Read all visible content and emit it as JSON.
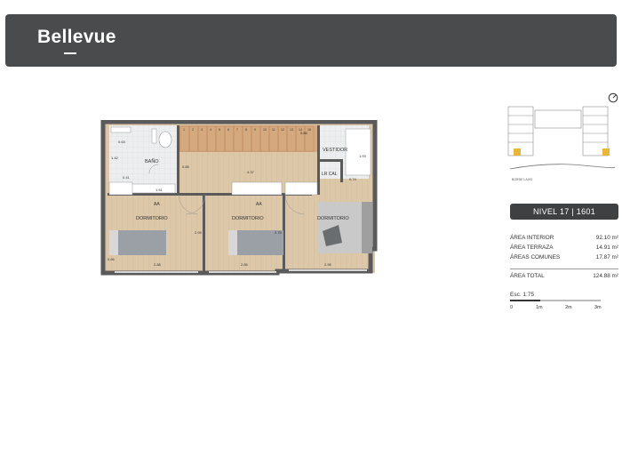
{
  "brand": {
    "name": "Bellevue"
  },
  "plan": {
    "stair_steps": [
      "1",
      "2",
      "3",
      "4",
      "5",
      "6",
      "7",
      "8",
      "9",
      "10",
      "11",
      "12",
      "13",
      "14",
      "15"
    ],
    "rooms": {
      "bath": "BAÑO",
      "vestibule": "VESTIDOR",
      "utility": "LR CAL",
      "bed1": "DORMITORIO",
      "bed2": "DORMITORIO",
      "bed3": "DORMITORIO",
      "ac1": "AA",
      "ac2": "AA"
    },
    "dims": {
      "d1": "0.63",
      "d2": "1.42",
      "d3": "0.41",
      "d4": "1.51",
      "d5": "0.85",
      "d6": "4.37",
      "d7": "0.86",
      "d8": "1.93",
      "d9": "0.74",
      "d10": "2.88",
      "d11": "2.85",
      "d12": "2.95",
      "d13": "0.66",
      "d14": "2.99",
      "d15": "2.75"
    }
  },
  "keyplan": {
    "caption": "BORDE LAGO"
  },
  "level": {
    "label": "NIVEL 17 | 1601"
  },
  "areas": [
    {
      "label": "ÁREA INTERIOR",
      "value": "92.10 m²"
    },
    {
      "label": "ÁREA TERRAZA",
      "value": "14.91 m²"
    },
    {
      "label": "ÁREAS COMUNES",
      "value": "17.87 m²"
    }
  ],
  "total": {
    "label": "ÁREA TOTAL",
    "value": "124.88 m²"
  },
  "scale": {
    "label": "Esc. 1:75",
    "ticks": [
      "0",
      "1m",
      "2m",
      "3m"
    ]
  },
  "colors": {
    "header": "#4a4b4d",
    "wall": "#5a5a5a",
    "wood": "#d9c4a6",
    "tile": "#e9ebec"
  }
}
